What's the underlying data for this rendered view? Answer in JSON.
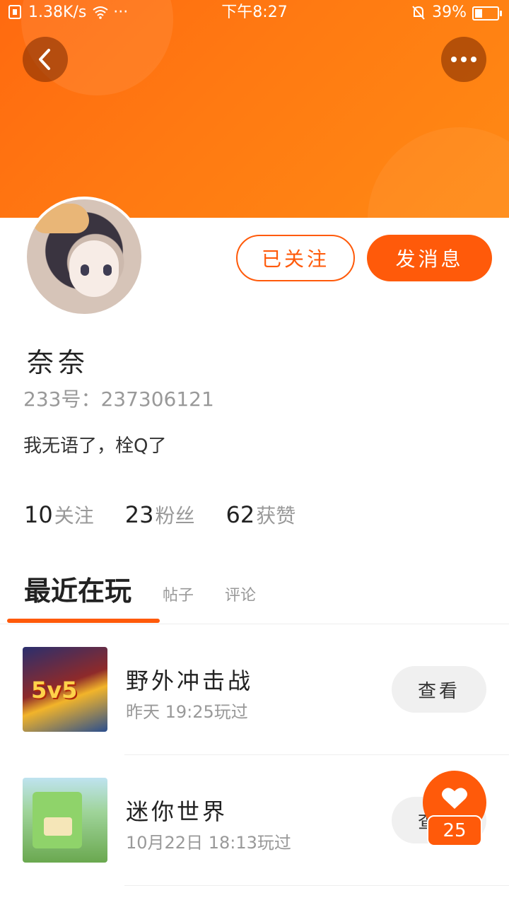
{
  "status_bar": {
    "net_speed": "1.38K/s",
    "dots": "···",
    "time": "下午8:27",
    "battery": "39%",
    "battery_level": 0.39
  },
  "header": {
    "back_icon": "chevron-left-icon",
    "more_icon": "more-horizontal-icon",
    "accent_color": "#ff5a0a"
  },
  "profile": {
    "followed_label": "已关注",
    "message_label": "发消息",
    "nickname": "奈奈",
    "uid": "233号：237306121",
    "bio": "我无语了，栓Q了"
  },
  "stats": [
    {
      "num": "10",
      "label": "关注"
    },
    {
      "num": "23",
      "label": "粉丝"
    },
    {
      "num": "62",
      "label": "获赞"
    }
  ],
  "tabs": [
    {
      "label": "最近在玩"
    },
    {
      "label": "帖子"
    },
    {
      "label": "评论"
    }
  ],
  "games": [
    {
      "title": "野外冲击战",
      "time": "昨天 19:25玩过",
      "button": "查看",
      "thumb_text": "5v5"
    },
    {
      "title": "迷你世界",
      "time": "10月22日 18:13玩过",
      "button": "查看"
    }
  ],
  "like": {
    "icon": "heart-icon",
    "count": "25"
  }
}
